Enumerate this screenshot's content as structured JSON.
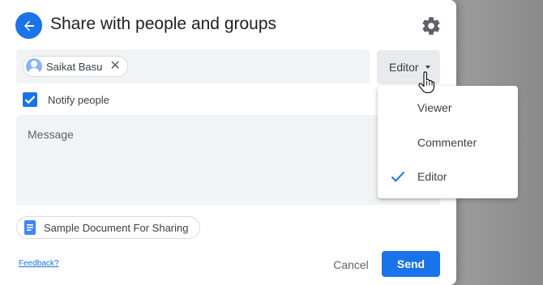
{
  "dialog": {
    "title": "Share with people and groups",
    "back_icon": "arrow-left-icon",
    "settings_icon": "gear-icon"
  },
  "recipients": {
    "chips": [
      {
        "name": "Saikat Basu",
        "avatar_icon": "person-icon",
        "remove_icon": "close-icon"
      }
    ]
  },
  "role_button": {
    "label": "Editor",
    "icon": "caret-down-icon"
  },
  "role_menu": {
    "items": [
      {
        "label": "Viewer",
        "selected": false
      },
      {
        "label": "Commenter",
        "selected": false
      },
      {
        "label": "Editor",
        "selected": true
      }
    ]
  },
  "notify": {
    "label": "Notify people",
    "checked": true
  },
  "message": {
    "placeholder": "Message",
    "value": ""
  },
  "document": {
    "name": "Sample Document For Sharing",
    "icon": "google-docs-icon"
  },
  "footer": {
    "feedback": "Feedback?",
    "cancel": "Cancel",
    "send": "Send"
  },
  "colors": {
    "accent": "#1a73e8",
    "field_bg": "#f1f3f4",
    "text": "#3c4043"
  }
}
